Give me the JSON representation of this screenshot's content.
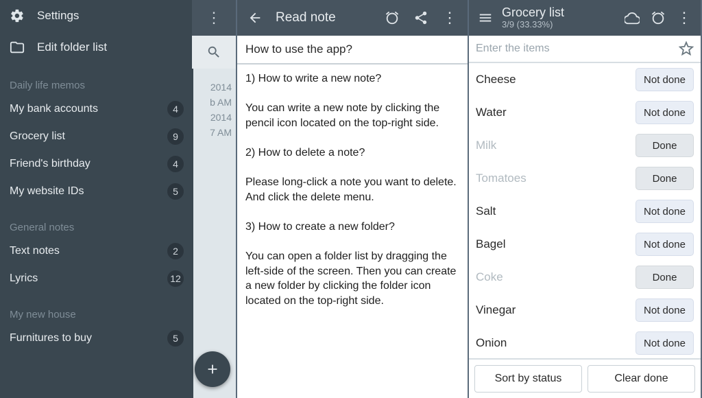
{
  "panelA": {
    "top": {
      "settings": "Settings",
      "editFolder": "Edit folder list"
    },
    "categories": [
      {
        "header": "Daily life memos",
        "folders": [
          {
            "name": "My bank accounts",
            "count": "4"
          },
          {
            "name": "Grocery list",
            "count": "9"
          },
          {
            "name": "Friend's birthday",
            "count": "4"
          },
          {
            "name": "My website IDs",
            "count": "5"
          }
        ]
      },
      {
        "header": "General notes",
        "folders": [
          {
            "name": "Text notes",
            "count": "2"
          },
          {
            "name": "Lyrics",
            "count": "12"
          }
        ]
      },
      {
        "header": "My new house",
        "folders": [
          {
            "name": "Furnitures to buy",
            "count": "5"
          }
        ]
      }
    ],
    "peek": {
      "lines": [
        "2014",
        "b AM",
        "2014",
        "7 AM"
      ]
    }
  },
  "panelB": {
    "headerTitle": "Read note",
    "noteTitle": "How to use the app?",
    "noteBody": "1) How to write a new note?\n\nYou can write a new note by clicking the pencil icon located on the top-right side.\n\n2) How to delete a note?\n\nPlease long-click a note you want to delete. And click the delete menu.\n\n3) How to create a new folder?\n\nYou can open a folder list by dragging the left-side of the screen. Then you can create a new folder by clicking the folder icon located on the top-right side."
  },
  "panelC": {
    "title": "Grocery list",
    "subtitle": "3/9 (33.33%)",
    "placeholder": "Enter the items",
    "labels": {
      "notDone": "Not done",
      "done": "Done"
    },
    "items": [
      {
        "name": "Cheese",
        "done": false
      },
      {
        "name": "Water",
        "done": false
      },
      {
        "name": "Milk",
        "done": true
      },
      {
        "name": "Tomatoes",
        "done": true
      },
      {
        "name": "Salt",
        "done": false
      },
      {
        "name": "Bagel",
        "done": false
      },
      {
        "name": "Coke",
        "done": true
      },
      {
        "name": "Vinegar",
        "done": false
      },
      {
        "name": "Onion",
        "done": false
      }
    ],
    "buttons": {
      "sort": "Sort by status",
      "clear": "Clear done"
    }
  }
}
